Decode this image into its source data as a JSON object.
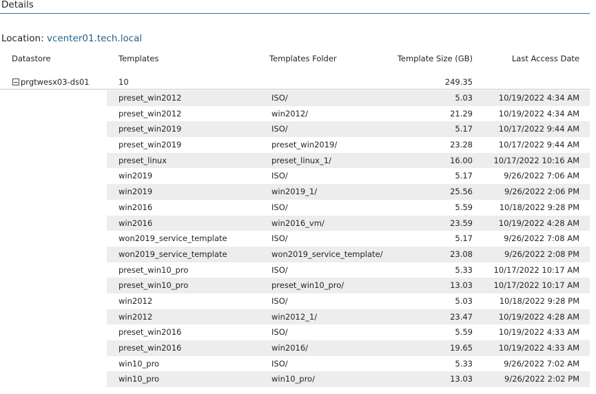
{
  "header": {
    "title": "Details"
  },
  "location": {
    "label": "Location:",
    "value": "vcenter01.tech.local"
  },
  "columns": {
    "datastore": "Datastore",
    "templates": "Templates",
    "folder": "Templates Folder",
    "size": "Template Size (GB)",
    "date": "Last Access Date"
  },
  "group": {
    "datastore": "prgtwesx03-ds01",
    "count": "10",
    "total_size": "249.35"
  },
  "rows": [
    {
      "template": "preset_win2012",
      "folder": "ISO/",
      "size": "5.03",
      "date": "10/19/2022 4:34 AM"
    },
    {
      "template": "preset_win2012",
      "folder": "win2012/",
      "size": "21.29",
      "date": "10/19/2022 4:34 AM"
    },
    {
      "template": "preset_win2019",
      "folder": "ISO/",
      "size": "5.17",
      "date": "10/17/2022 9:44 AM"
    },
    {
      "template": "preset_win2019",
      "folder": "preset_win2019/",
      "size": "23.28",
      "date": "10/17/2022 9:44 AM"
    },
    {
      "template": "preset_linux",
      "folder": "preset_linux_1/",
      "size": "16.00",
      "date": "10/17/2022 10:16 AM"
    },
    {
      "template": "win2019",
      "folder": "ISO/",
      "size": "5.17",
      "date": "9/26/2022 7:06 AM"
    },
    {
      "template": "win2019",
      "folder": "win2019_1/",
      "size": "25.56",
      "date": "9/26/2022 2:06 PM"
    },
    {
      "template": "win2016",
      "folder": "ISO/",
      "size": "5.59",
      "date": "10/18/2022 9:28 PM"
    },
    {
      "template": "win2016",
      "folder": "win2016_vm/",
      "size": "23.59",
      "date": "10/19/2022 4:28 AM"
    },
    {
      "template": "won2019_service_template",
      "folder": "ISO/",
      "size": "5.17",
      "date": "9/26/2022 7:08 AM"
    },
    {
      "template": "won2019_service_template",
      "folder": "won2019_service_template/",
      "size": "23.08",
      "date": "9/26/2022 2:08 PM"
    },
    {
      "template": "preset_win10_pro",
      "folder": "ISO/",
      "size": "5.33",
      "date": "10/17/2022 10:17 AM"
    },
    {
      "template": "preset_win10_pro",
      "folder": "preset_win10_pro/",
      "size": "13.03",
      "date": "10/17/2022 10:17 AM"
    },
    {
      "template": "win2012",
      "folder": "ISO/",
      "size": "5.03",
      "date": "10/18/2022 9:28 PM"
    },
    {
      "template": "win2012",
      "folder": "win2012_1/",
      "size": "23.47",
      "date": "10/19/2022 4:28 AM"
    },
    {
      "template": "preset_win2016",
      "folder": "ISO/",
      "size": "5.59",
      "date": "10/19/2022 4:33 AM"
    },
    {
      "template": "preset_win2016",
      "folder": "win2016/",
      "size": "19.65",
      "date": "10/19/2022 4:33 AM"
    },
    {
      "template": "win10_pro",
      "folder": "ISO/",
      "size": "5.33",
      "date": "9/26/2022 7:02 AM"
    },
    {
      "template": "win10_pro",
      "folder": "win10_pro/",
      "size": "13.03",
      "date": "9/26/2022 2:02 PM"
    }
  ]
}
